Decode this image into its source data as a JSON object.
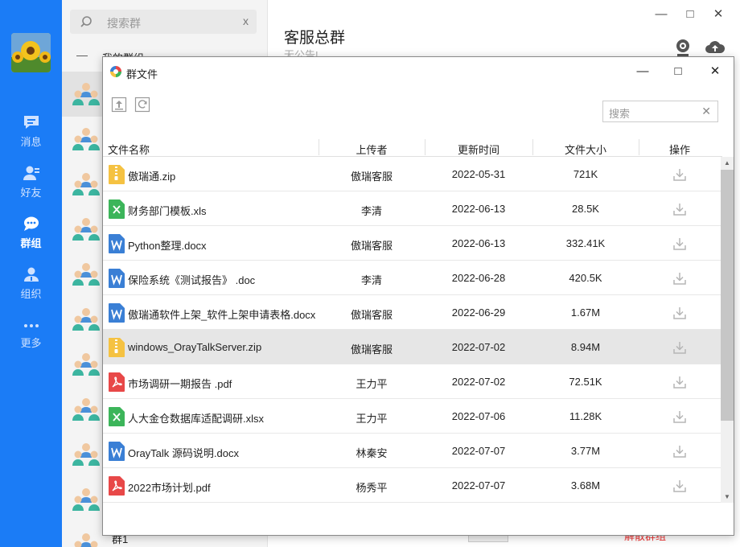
{
  "nav": {
    "items": [
      {
        "label": "消息",
        "icon": "message-icon"
      },
      {
        "label": "好友",
        "icon": "friend-icon"
      },
      {
        "label": "群组",
        "icon": "group-chat-icon"
      },
      {
        "label": "组织",
        "icon": "organization-icon"
      },
      {
        "label": "更多",
        "icon": "more-icon"
      }
    ],
    "active": "群组"
  },
  "group_list": {
    "search_placeholder": "搜索群",
    "search_clear": "x",
    "section_label": "我的群组",
    "section_toggle": "—",
    "bottom_item_label": "群1"
  },
  "chat": {
    "title": "客服总群",
    "announcement": "无公告!",
    "bottom_action": "解散群组",
    "window_controls": {
      "minimize": "—",
      "maximize": "□",
      "close": "✕"
    }
  },
  "dialog": {
    "title": "群文件",
    "controls": {
      "minimize": "—",
      "maximize": "□",
      "close": "✕"
    },
    "search_placeholder": "搜索",
    "search_clear": "✕",
    "columns": {
      "name": "文件名称",
      "uploader": "上传者",
      "updated": "更新时间",
      "size": "文件大小",
      "action": "操作"
    },
    "files": [
      {
        "name": "傲瑞通.zip",
        "type": "zip",
        "uploader": "傲瑞客服",
        "updated": "2022-05-31",
        "size": "721K"
      },
      {
        "name": "财务部门模板.xls",
        "type": "xls",
        "uploader": "李清",
        "updated": "2022-06-13",
        "size": "28.5K"
      },
      {
        "name": "Python整理.docx",
        "type": "doc",
        "uploader": "傲瑞客服",
        "updated": "2022-06-13",
        "size": "332.41K"
      },
      {
        "name": "保险系统《测试报告》 .doc",
        "type": "doc",
        "uploader": "李清",
        "updated": "2022-06-28",
        "size": "420.5K"
      },
      {
        "name": "傲瑞通软件上架_软件上架申请表格.docx",
        "type": "doc",
        "uploader": "傲瑞客服",
        "updated": "2022-06-29",
        "size": "1.67M"
      },
      {
        "name": "windows_OrayTalkServer.zip",
        "type": "zip",
        "uploader": "傲瑞客服",
        "updated": "2022-07-02",
        "size": "8.94M"
      },
      {
        "name": "市场调研一期报告 .pdf",
        "type": "pdf",
        "uploader": "王力平",
        "updated": "2022-07-02",
        "size": "72.51K"
      },
      {
        "name": "人大金仓数据库适配调研.xlsx",
        "type": "xls",
        "uploader": "王力平",
        "updated": "2022-07-06",
        "size": "11.28K"
      },
      {
        "name": "OrayTalk 源码说明.docx",
        "type": "doc",
        "uploader": "林秦安",
        "updated": "2022-07-07",
        "size": "3.77M"
      },
      {
        "name": "2022市场计划.pdf",
        "type": "pdf",
        "uploader": "杨秀平",
        "updated": "2022-07-07",
        "size": "3.68M"
      }
    ],
    "selected_index": 5
  },
  "colors": {
    "nav_bg": "#1b7cf6",
    "zip": "#f5c242",
    "xls": "#3cb55a",
    "doc": "#3a7fd5",
    "pdf": "#e84848"
  }
}
